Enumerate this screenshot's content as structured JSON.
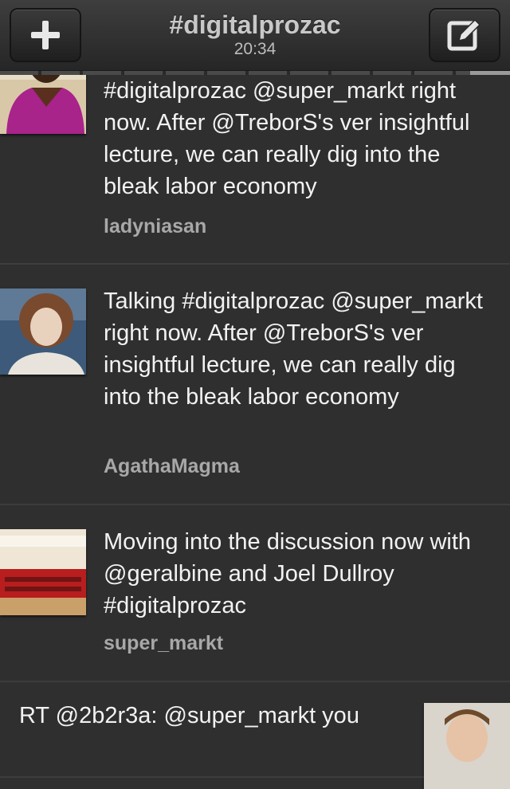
{
  "header": {
    "title": "#digitalprozac",
    "time": "20:34",
    "left_icon": "plus-icon",
    "right_icon": "compose-icon"
  },
  "tweets": [
    {
      "text": "#digitalprozac @super_markt right now. After @TreborS's ver insightful lecture, we can really dig into the bleak labor economy",
      "user": "ladyniasan"
    },
    {
      "text": "Talking #digitalprozac @super_markt right now. After @TreborS's ver insightful lecture, we can really dig into the bleak labor economy",
      "user": "AgathaMagma"
    },
    {
      "text": "Moving into the discussion now with @geralbine and Joel Dullroy #digitalprozac",
      "user": "super_markt"
    },
    {
      "text": "RT @2b2r3a: @super_markt you",
      "user": ""
    }
  ],
  "colors": {
    "background": "#2f2f2f",
    "text": "#f2f2f2",
    "username": "#a8a8a8"
  }
}
